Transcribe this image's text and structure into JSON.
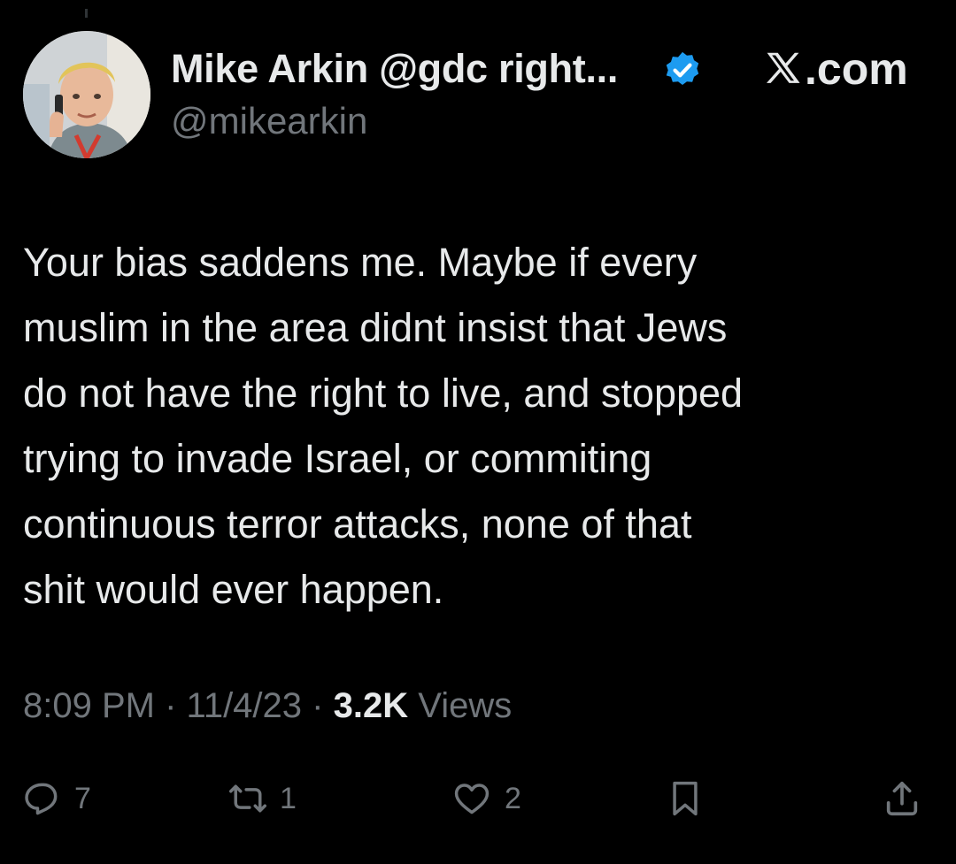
{
  "author": {
    "display_name": "Mike Arkin @gdc right...",
    "handle": "@mikearkin",
    "verified_badge_color": "#1d9bf0"
  },
  "brand": {
    "icon": "x-logo-icon",
    "suffix": ".com"
  },
  "tweet": {
    "text": "Your bias saddens me.  Maybe if every\nmuslim in the area didnt insist that Jews\ndo not have the right to live, and stopped\ntrying to invade Israel, or commiting\ncontinuous terror attacks, none of that\nshit would ever happen."
  },
  "meta": {
    "time": "8:09 PM",
    "separator": "·",
    "date": "11/4/23",
    "views_count": "3.2K",
    "views_label": "Views"
  },
  "actions": {
    "reply": {
      "icon": "reply-icon",
      "count": "7"
    },
    "retweet": {
      "icon": "retweet-icon",
      "count": "1"
    },
    "like": {
      "icon": "heart-icon",
      "count": "2"
    },
    "bookmark": {
      "icon": "bookmark-icon"
    },
    "share": {
      "icon": "share-icon"
    }
  },
  "colors": {
    "background": "#000000",
    "primary_text": "#e7e9ea",
    "secondary_text": "#71767b",
    "accent": "#1d9bf0"
  }
}
